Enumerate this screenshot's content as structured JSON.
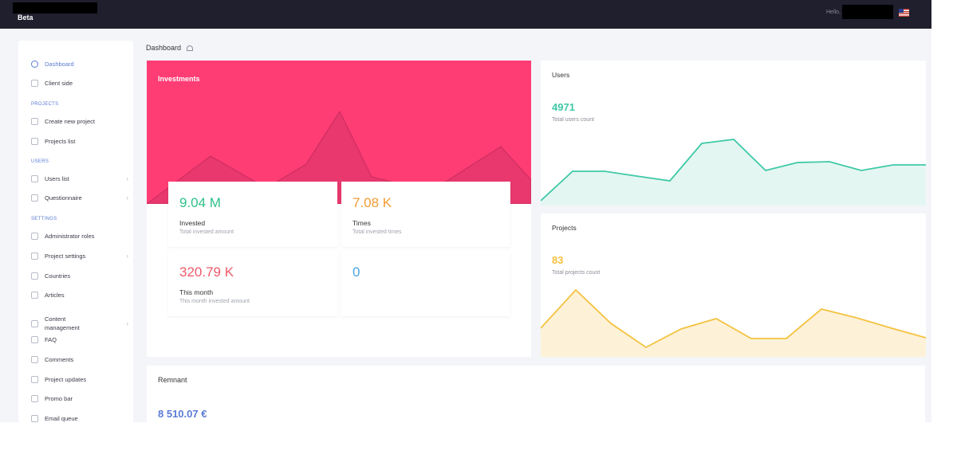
{
  "app": {
    "brand": "Beta",
    "greeting": "Hello,"
  },
  "colors": {
    "accent": "#5b7bd5",
    "investments": "#ff3d75",
    "users": "#3ec9a7",
    "projects": "#f4c23f",
    "stat_green": "#2ec088",
    "stat_orange": "#f39c34",
    "stat_red": "#ee5a6a",
    "stat_blue": "#4aa3df"
  },
  "sidebar": {
    "items": [
      {
        "label": "Dashboard",
        "icon": "dashboard-icon",
        "active": true
      },
      {
        "label": "Client side",
        "icon": "home-icon"
      },
      {
        "section": "PROJECTS"
      },
      {
        "label": "Create new project",
        "icon": "edit-icon"
      },
      {
        "label": "Projects list",
        "icon": "list-icon"
      },
      {
        "section": "USERS"
      },
      {
        "label": "Users list",
        "icon": "users-icon",
        "chevron": "›"
      },
      {
        "label": "Questionnaire",
        "icon": "clipboard-icon",
        "chevron": "›"
      },
      {
        "section": "SETTINGS"
      },
      {
        "label": "Administrator roles",
        "icon": "lock-icon"
      },
      {
        "label": "Project settings",
        "icon": "gear-icon",
        "chevron": "›"
      },
      {
        "label": "Countries",
        "icon": "globe-icon"
      },
      {
        "label": "Articles",
        "icon": "article-icon"
      },
      {
        "label": "Content management",
        "icon": "folder-icon",
        "chevron": "›"
      },
      {
        "label": "FAQ",
        "icon": "question-icon"
      },
      {
        "label": "Comments",
        "icon": "comment-icon"
      },
      {
        "label": "Project updates",
        "icon": "updates-icon"
      },
      {
        "label": "Promo bar",
        "icon": "megaphone-icon"
      },
      {
        "label": "Email queue",
        "icon": "email-icon"
      }
    ]
  },
  "breadcrumb": {
    "label": "Dashboard"
  },
  "investments": {
    "title": "Investments",
    "stats": [
      {
        "value": "9.04 M",
        "label": "Invested",
        "sub": "Total invested amount",
        "color": "#2ec088"
      },
      {
        "value": "7.08 K",
        "label": "Times",
        "sub": "Total invested times",
        "color": "#f39c34"
      },
      {
        "value": "320.79 K",
        "label": "This month",
        "sub": "This month invested amount",
        "color": "#ee5a6a"
      },
      {
        "value": "0",
        "label": "",
        "sub": "",
        "color": "#4aa3df"
      }
    ]
  },
  "users": {
    "title": "Users",
    "count": "4971",
    "caption": "Total users count"
  },
  "projects": {
    "title": "Projects",
    "count": "83",
    "caption": "Total projects count"
  },
  "remnant": {
    "title": "Remnant",
    "amount": "8 510.07 €"
  }
}
